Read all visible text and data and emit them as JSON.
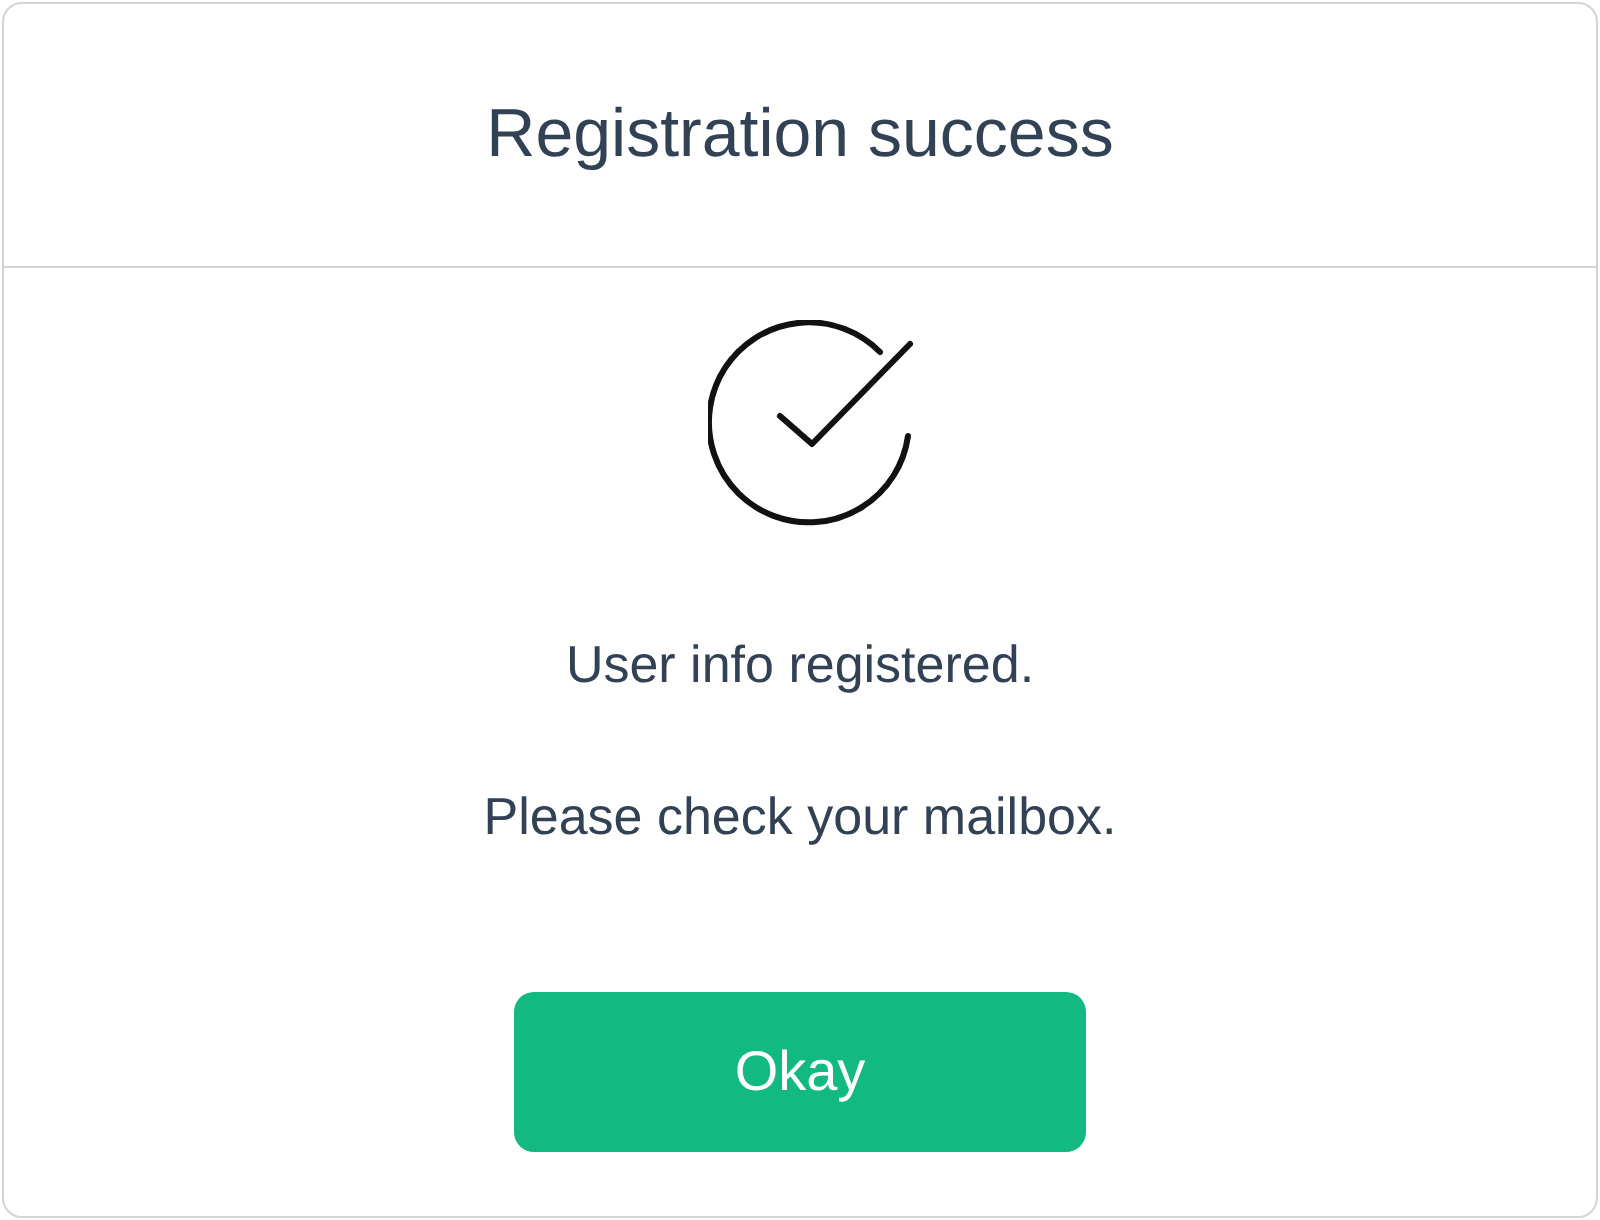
{
  "dialog": {
    "title": "Registration success",
    "messages": [
      "User info registered.",
      "Please check your mailbox."
    ],
    "button": "Okay"
  }
}
